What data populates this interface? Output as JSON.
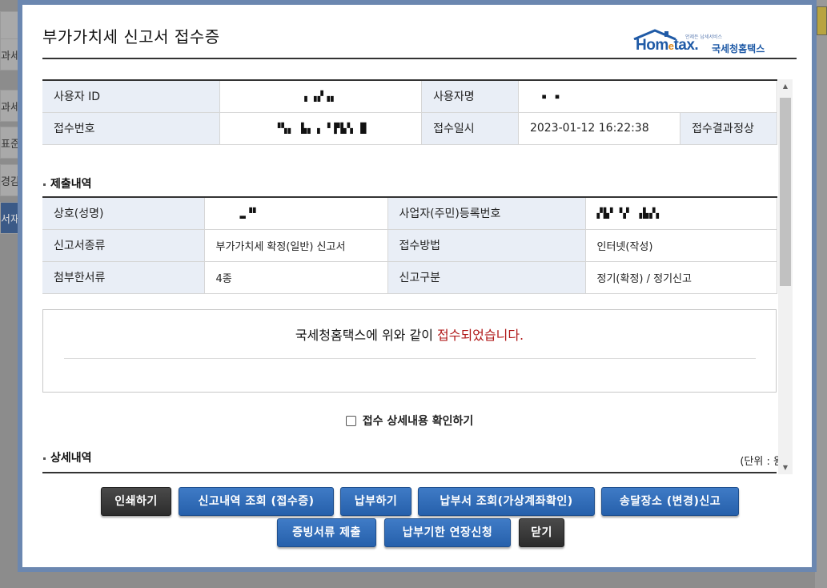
{
  "background": {
    "left_items": [
      "과세",
      "과세",
      "표준",
      "경감",
      "서재"
    ]
  },
  "modal": {
    "title": "부가가치세 신고서 접수증",
    "logo": {
      "main_pre": "Hom",
      "main_e": "e",
      "main_post": "tax.",
      "korean": "국세청홈택스",
      "small": "언제든 납세서비스"
    }
  },
  "receipt": {
    "user_id_label": "사용자 ID",
    "user_id_value": "▖▗▞▗▖",
    "user_name_label": "사용자명",
    "user_name_value": "▪ ▪",
    "receipt_no_label": "접수번호",
    "receipt_no_value": "▝▚▖ ▙▖▗ ▘▛▙▚ █",
    "receipt_date_label": "접수일시",
    "receipt_date_value": "2023-01-12 16:22:38",
    "result_label": "접수결과",
    "result_value": "정상"
  },
  "submission": {
    "section_title": "제출내역",
    "company_label": "상호(성명)",
    "company_value": "▂▝▘",
    "bizno_label": "사업자(주민)등록번호",
    "bizno_value": "▞▙▘▝▞ ▗▙▞▖",
    "report_type_label": "신고서종류",
    "report_type_value": "부가가치세 확정(일반) 신고서",
    "method_label": "접수방법",
    "method_value": "인터넷(작성)",
    "attach_label": "첨부한서류",
    "attach_value": "4종",
    "category_label": "신고구분",
    "category_value": "정기(확정) / 정기신고"
  },
  "notice": {
    "text_pre": "국세청홈택스에 위와 같이 ",
    "text_red": "접수되었습니다."
  },
  "check": {
    "label": "접수 상세내용 확인하기"
  },
  "detail": {
    "section_title": "상세내역",
    "unit": "(단위 : 원)"
  },
  "buttons": {
    "print": "인쇄하기",
    "history": "신고내역 조회 (접수증)",
    "pay": "납부하기",
    "bill": "납부서 조회(가상계좌확인)",
    "address": "송달장소 (변경)신고",
    "evidence": "증빙서류 제출",
    "extension": "납부기한 연장신청",
    "close": "닫기"
  },
  "colors": {
    "modal_frame": "#6b87b0",
    "header_cell": "#e9eef6",
    "button_blue": "#2f6db8",
    "button_dark": "#333333",
    "notice_red": "#b01818"
  }
}
